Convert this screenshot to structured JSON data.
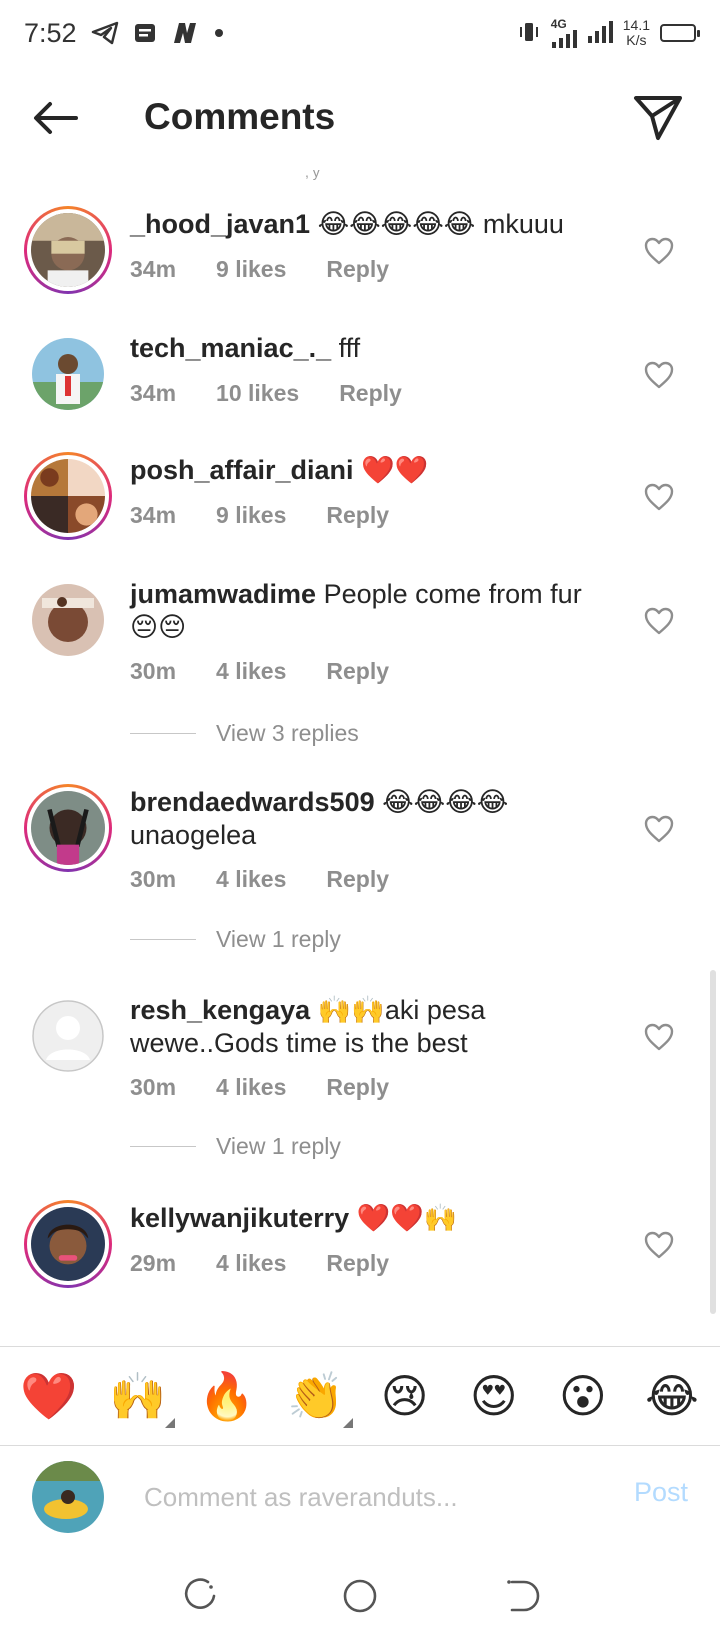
{
  "status_bar": {
    "time": "7:52",
    "network": "4G",
    "speed_value": "14.1",
    "speed_unit": "K/s",
    "left_icons": [
      "telegram-icon",
      "notes-icon",
      "n-app-icon",
      "dot-icon"
    ]
  },
  "header": {
    "title": "Comments"
  },
  "comments": [
    {
      "user": "_hood_javan1",
      "text": "😂😂😂😂😂 mkuuu",
      "time": "34m",
      "likes": "9 likes",
      "reply": "Reply",
      "story_ring": true
    },
    {
      "user": "tech_maniac_._",
      "text": "fff",
      "time": "34m",
      "likes": "10 likes",
      "reply": "Reply",
      "story_ring": false
    },
    {
      "user": "posh_affair_diani",
      "text": "❤️❤️",
      "time": "34m",
      "likes": "9 likes",
      "reply": "Reply",
      "story_ring": true
    },
    {
      "user": "jumamwadime",
      "text": "People come from fur 😔😔",
      "time": "30m",
      "likes": "4 likes",
      "reply": "Reply",
      "story_ring": false
    },
    {
      "user": "brendaedwards509",
      "text": "😂😂😂😂 unaogelea",
      "time": "30m",
      "likes": "4 likes",
      "reply": "Reply",
      "story_ring": true
    },
    {
      "user": "resh_kengaya",
      "text": "🙌🙌aki pesa wewe..Gods time is the best",
      "time": "30m",
      "likes": "4 likes",
      "reply": "Reply",
      "story_ring": false
    },
    {
      "user": "kellywanjikuterry",
      "text": "❤️❤️🙌",
      "time": "29m",
      "likes": "4 likes",
      "reply": "Reply",
      "story_ring": true
    }
  ],
  "view_replies": [
    "View 3 replies",
    "View 1 reply",
    "View 1 reply"
  ],
  "emoji_bar": [
    "❤️",
    "🙌",
    "🔥",
    "👏",
    "😢",
    "😍",
    "😮",
    "😂"
  ],
  "composer": {
    "placeholder": "Comment as raveranduts...",
    "post_label": "Post"
  },
  "colors": {
    "accent_blue": "#b3dbff",
    "meta_gray": "#8e8e8e",
    "text": "#262626"
  }
}
